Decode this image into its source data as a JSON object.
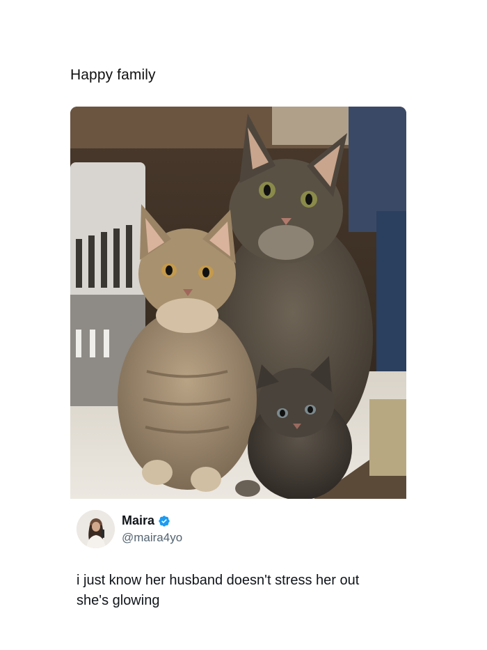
{
  "post": {
    "caption": "Happy family"
  },
  "tweet": {
    "display_name": "Maira",
    "handle": "@maira4yo",
    "verified": true,
    "text_line1": "i just know her husband doesn't stress her out",
    "text_line2": "she's glowing"
  },
  "colors": {
    "verified_badge": "#1d9bf0",
    "handle": "#536471",
    "text": "#0f1419"
  },
  "icons": {
    "verified": "verified-badge-icon"
  }
}
